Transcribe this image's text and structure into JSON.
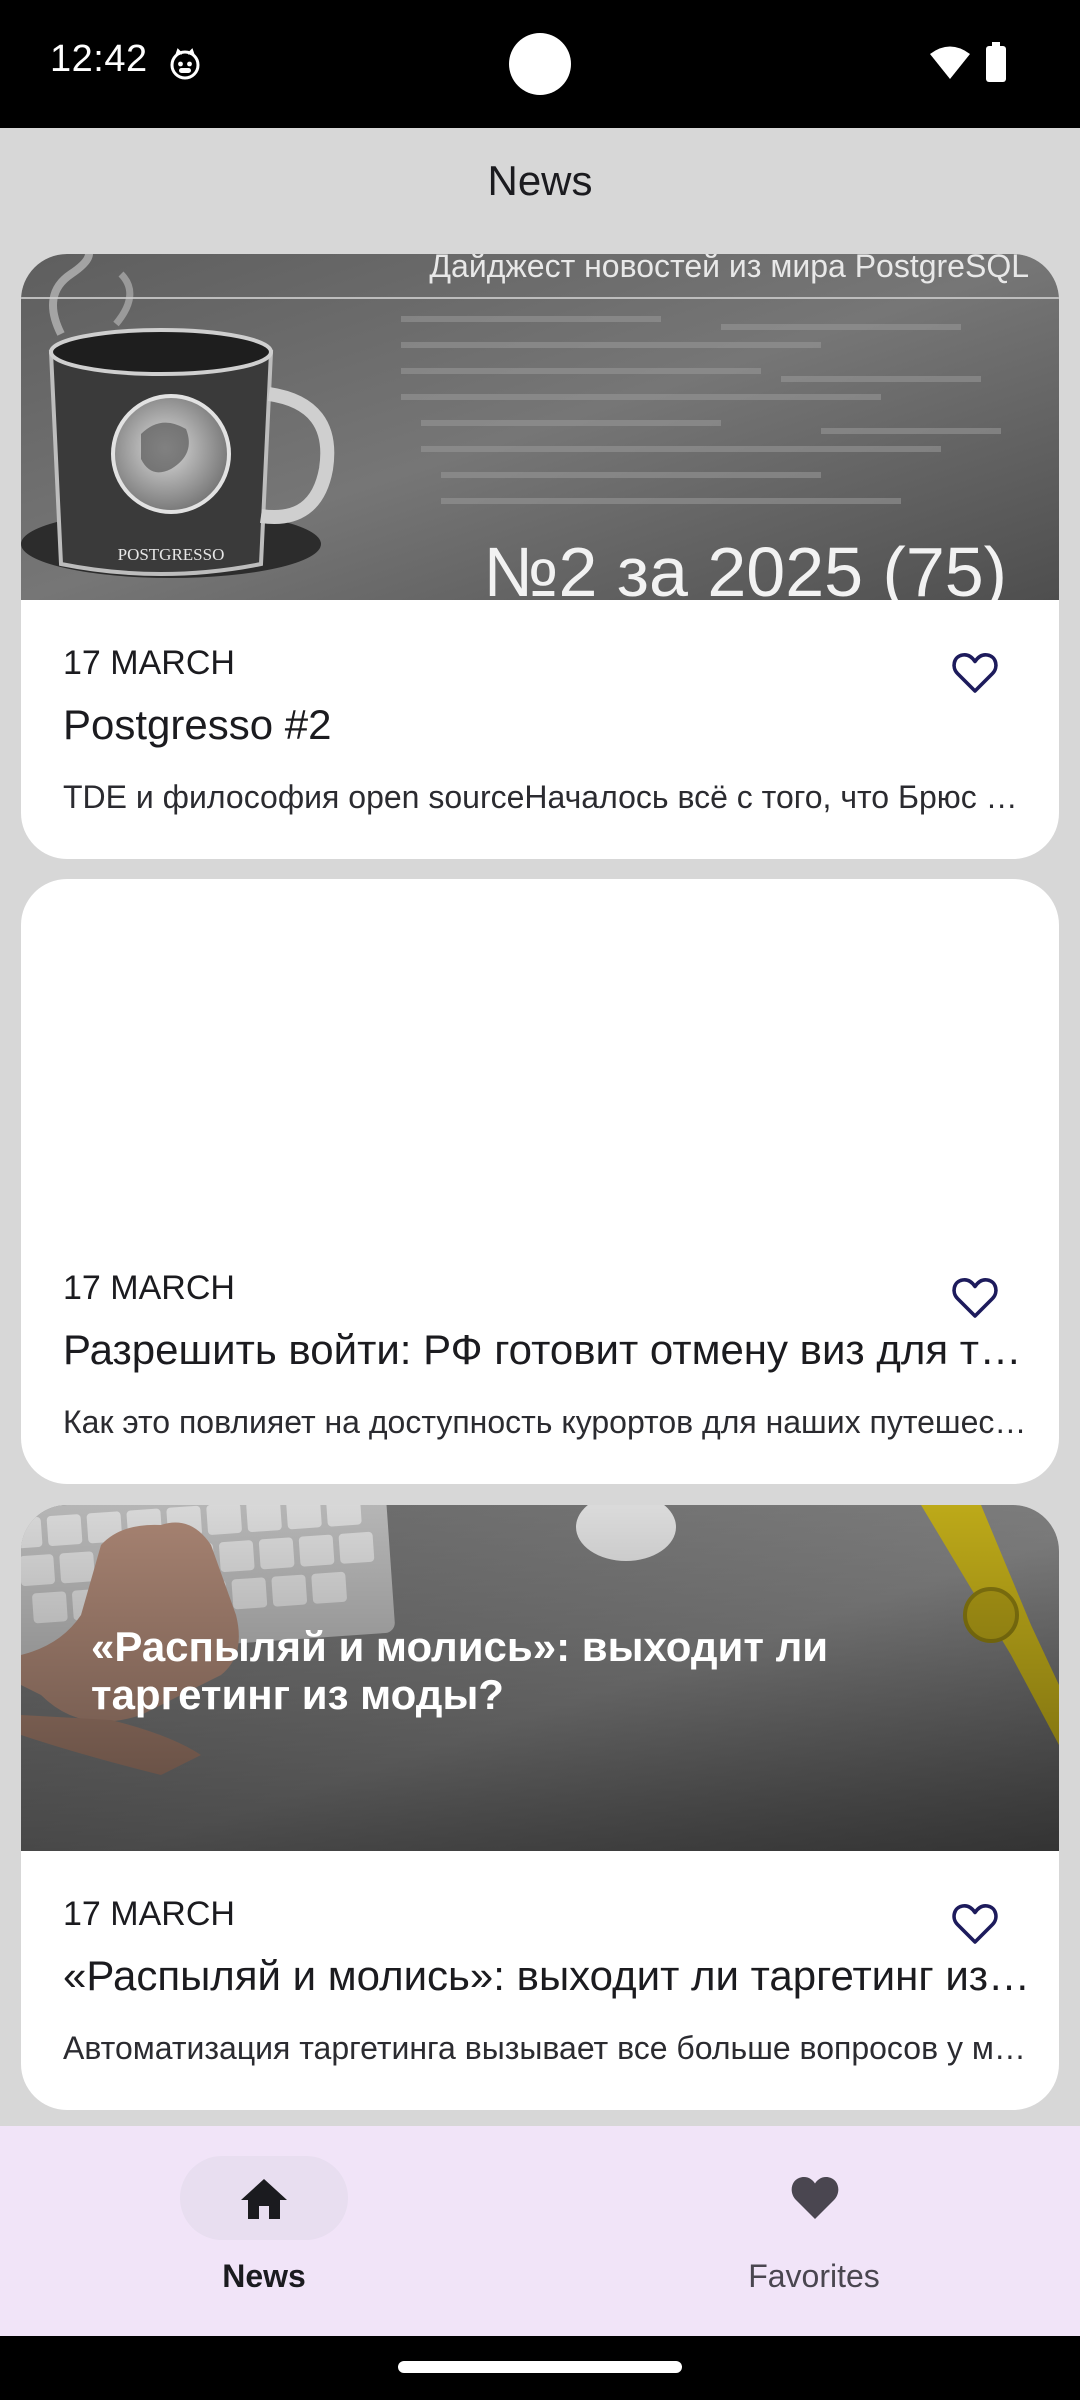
{
  "status_bar": {
    "time": "12:42",
    "app_icon": "cat-face-icon",
    "wifi_icon": "wifi-icon",
    "battery_icon": "battery-icon"
  },
  "header": {
    "title": "News"
  },
  "news": [
    {
      "date": "17 MARCH",
      "title": "Postgresso #2",
      "description": "TDE и философия open sourceНачалось всё с того, что Брюс Момжан",
      "image": {
        "kind": "banner",
        "top_text": "Дайджест новостей из мира PostgreSQL",
        "mug_label": "POSTGRESSO",
        "number_text": "№2 за 2025 (75)"
      },
      "favorite_icon": "heart-outline-icon",
      "favorited": false
    },
    {
      "date": "17 MARCH",
      "title": "Разрешить войти: РФ готовит отмену виз для туристов",
      "description": "Как это повлияет на доступность курортов для наших путешественников",
      "image": {
        "kind": "empty"
      },
      "favorite_icon": "heart-outline-icon",
      "favorited": false
    },
    {
      "date": "17 MARCH",
      "title": "«Распыляй и молись»: выходит ли таргетинг из моды?",
      "description": "Автоматизация таргетинга вызывает все больше вопросов у маркетологов",
      "image": {
        "kind": "photo",
        "overlay_text": "«Распыляй и молись»: выходит ли таргетинг из моды?"
      },
      "favorite_icon": "heart-outline-icon",
      "favorited": false
    }
  ],
  "bottom_nav": {
    "items": [
      {
        "label": "News",
        "icon": "home-icon",
        "active": true
      },
      {
        "label": "Favorites",
        "icon": "heart-filled-icon",
        "active": false
      }
    ]
  },
  "colors": {
    "background": "#d7d7d7",
    "card": "#ffffff",
    "heart_outline": "#1d1b5c",
    "nav_background": "#f1e4f8",
    "nav_indicator": "#e8def0"
  }
}
